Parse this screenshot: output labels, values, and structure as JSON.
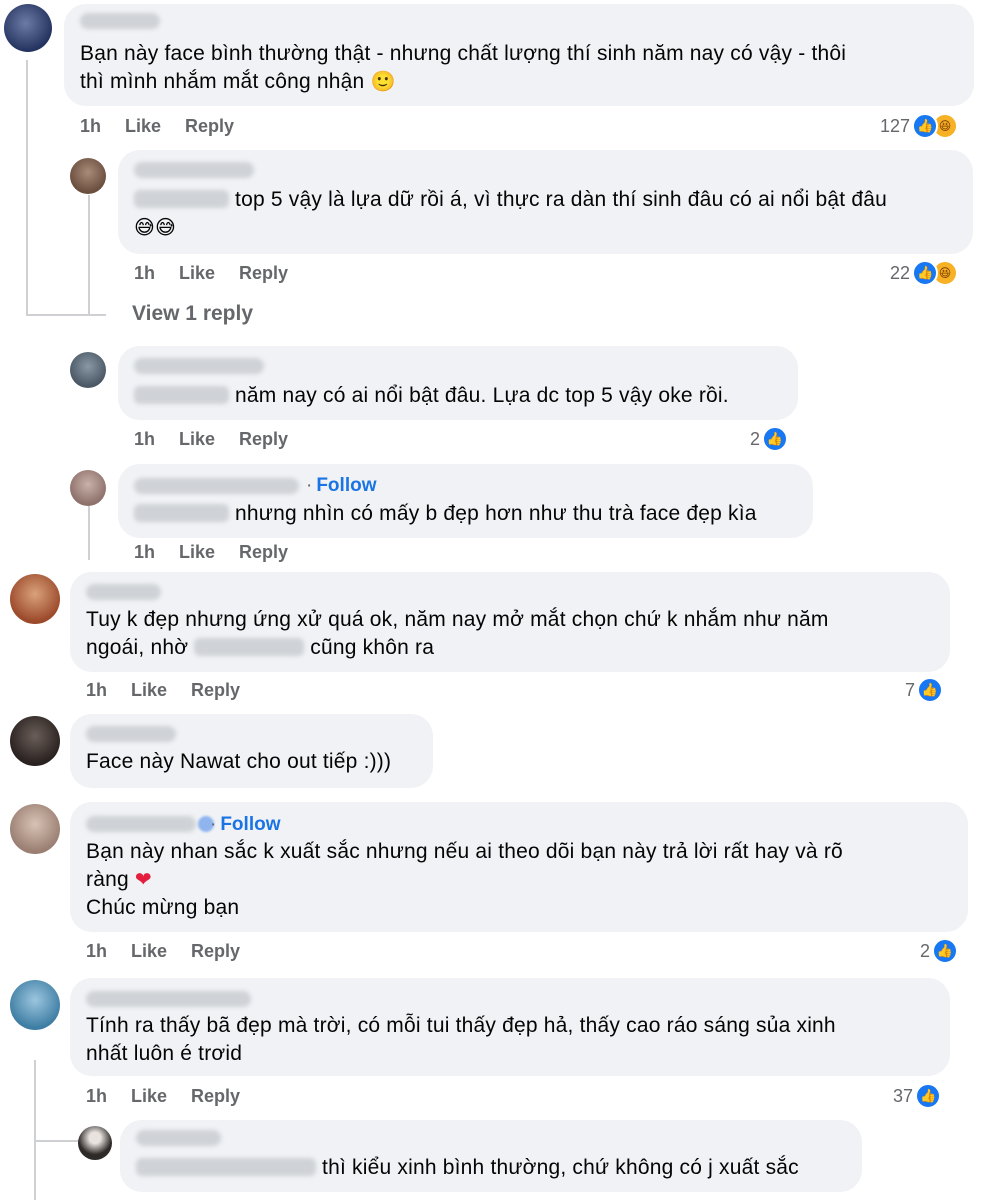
{
  "comments": [
    {
      "text_line1": "Bạn này face bình thường thật - nhưng chất lượng thí sinh năm nay có vậy - thôi",
      "text_line2": "thì mình nhắm mắt công nhận",
      "emoji": "🙂",
      "time": "1h",
      "like": "Like",
      "reply": "Reply",
      "reactions": "127"
    },
    {
      "text_line1": "top 5 vậy là lựa dữ rồi á, vì thực ra dàn thí sinh đâu có ai nổi bật đâu",
      "emoji": "😅😅",
      "time": "1h",
      "like": "Like",
      "reply": "Reply",
      "reactions": "22"
    },
    {
      "view_replies": "View 1 reply"
    },
    {
      "text_line1": "năm nay có ai nổi bật đâu. Lựa dc top 5 vậy oke rồi.",
      "time": "1h",
      "like": "Like",
      "reply": "Reply",
      "reactions": "2"
    },
    {
      "follow": "Follow",
      "text_line1": "nhưng nhìn có mấy b đẹp hơn như thu trà face đẹp kìa",
      "time": "1h",
      "like": "Like",
      "reply": "Reply"
    },
    {
      "text_line1": "Tuy k đẹp nhưng ứng xử quá ok, năm nay mở mắt chọn chứ k nhắm như năm",
      "text_line2a": "ngoái, nhờ",
      "text_line2b": "cũng khôn ra",
      "time": "1h",
      "like": "Like",
      "reply": "Reply",
      "reactions": "7"
    },
    {
      "text_line1": "Face này Nawat cho out tiếp :)))"
    },
    {
      "follow": "Follow",
      "text_line1": "Bạn này nhan sắc k xuất sắc nhưng nếu ai theo dõi bạn này trả lời rất hay và rõ",
      "text_line2": "ràng",
      "emoji": "❤",
      "text_line3": "Chúc mừng bạn",
      "time": "1h",
      "like": "Like",
      "reply": "Reply",
      "reactions": "2"
    },
    {
      "text_line1": "Tính ra thấy bã đẹp mà trời, có mỗi tui thấy đẹp hả, thấy cao ráo sáng sủa xinh",
      "text_line2": "nhất luôn é trơid",
      "time": "1h",
      "like": "Like",
      "reply": "Reply",
      "reactions": "37"
    },
    {
      "text_line1": "thì kiểu xinh bình thường, chứ không có j xuất sắc"
    }
  ],
  "icons": {
    "like": "like-reaction-icon",
    "haha": "haha-reaction-icon"
  },
  "colors": {
    "accent": "#1877f2",
    "bubble": "#f0f2f5",
    "meta": "#65676b",
    "haha": "#f7b125"
  }
}
